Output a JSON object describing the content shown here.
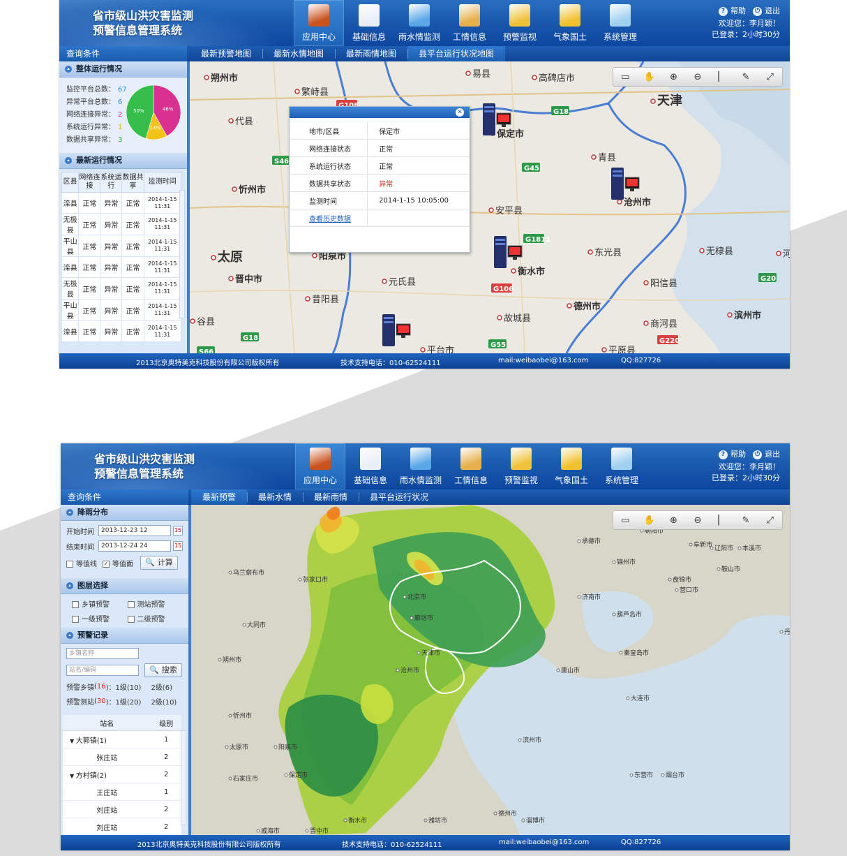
{
  "screens": [
    {
      "header": {
        "title_line1": "省市级山洪灾害监测",
        "title_line2": "预警信息管理系统",
        "nav": [
          {
            "label": "应用中心",
            "icon": "house-icon",
            "color": "#c9531e"
          },
          {
            "label": "基础信息",
            "icon": "document-icon",
            "color": "#e9eef7"
          },
          {
            "label": "雨水情监测",
            "icon": "rain-icon",
            "color": "#5aa8e8"
          },
          {
            "label": "工情信息",
            "icon": "report-icon",
            "color": "#e6b04c"
          },
          {
            "label": "预警监视",
            "icon": "warning-monitor-icon",
            "color": "#f0c23a"
          },
          {
            "label": "气象国土",
            "icon": "weather-icon",
            "color": "#f2c12f"
          },
          {
            "label": "系统管理",
            "icon": "settings-monitor-icon",
            "color": "#9fd0f0"
          }
        ],
        "help": "帮助",
        "logout": "退出",
        "welcome": "欢迎您：李月颖！",
        "logged": "已登录：2小时30分"
      },
      "query_title": "查询条件",
      "tabs": [
        "最新预警地图",
        "最新水情地图",
        "最新雨情地图",
        "县平台运行状况地图"
      ],
      "active_tab": 3,
      "overall": {
        "title": "整体运行情况",
        "rows": [
          {
            "label": "监控平台总数：",
            "value": "67",
            "color": "#2b8fe0"
          },
          {
            "label": "异常平台总数：",
            "value": "6",
            "color": "#2b8fe0"
          },
          {
            "label": "网络连接异常：",
            "value": "2",
            "color": "#d6197c"
          },
          {
            "label": "系统运行异常：",
            "value": "1",
            "color": "#e8b51a"
          },
          {
            "label": "数据共享异常：",
            "value": "3",
            "color": "#2aa83c"
          }
        ],
        "pie": [
          {
            "label": "46%",
            "value": 46,
            "color": "#d9318f"
          },
          {
            "label": "14%",
            "value": 14,
            "color": "#f2c218"
          },
          {
            "label": "50%",
            "value": 50,
            "color": "#35be49"
          }
        ]
      },
      "latest": {
        "title": "最新运行情况",
        "headers": [
          "区县",
          "网络连接",
          "系统运行",
          "数据共享",
          "监测时间"
        ],
        "rows": [
          [
            "滦县",
            "正常",
            "异常",
            "正常",
            "2014-1-15 11:31"
          ],
          [
            "无极县",
            "正常",
            "异常",
            "正常",
            "2014-1-15 11:31"
          ],
          [
            "平山县",
            "正常",
            "异常",
            "正常",
            "2014-1-15 11:31"
          ],
          [
            "滦县",
            "正常",
            "异常",
            "正常",
            "2014-1-15 11:31"
          ],
          [
            "无极县",
            "正常",
            "异常",
            "正常",
            "2014-1-15 11:31"
          ],
          [
            "平山县",
            "正常",
            "异常",
            "正常",
            "2014-1-15 11:31"
          ],
          [
            "滦县",
            "正常",
            "异常",
            "正常",
            "2014-1-15 11:31"
          ]
        ]
      },
      "popup": {
        "rows": [
          {
            "label": "地市/区县",
            "value": "保定市",
            "color": "#222"
          },
          {
            "label": "网络连接状态",
            "value": "正常",
            "color": "#222"
          },
          {
            "label": "系统运行状态",
            "value": "正常",
            "color": "#222"
          },
          {
            "label": "数据共享状态",
            "value": "异常",
            "color": "#d42020"
          },
          {
            "label": "监测时间",
            "value": "2014-1-15 10:05:00",
            "color": "#222"
          }
        ],
        "link": "查看历史数据"
      },
      "map_labels": [
        "朔州市",
        "繁峙县",
        "易县",
        "高碑店市",
        "天津",
        "代县",
        "保定市",
        "青县",
        "忻州市",
        "安平县",
        "沧州市",
        "太原",
        "阳泉市",
        "东光县",
        "无棣县",
        "晋中市",
        "衡水市",
        "元氏县",
        "阳信县",
        "昔阳县",
        "德州市",
        "河",
        "故城县",
        "商河县",
        "滨州市",
        "谷县",
        "平台市",
        "平原县"
      ],
      "road_shields": [
        "G108",
        "G18",
        "S46",
        "G45",
        "G1811",
        "G106",
        "G18",
        "G55",
        "G20",
        "G220",
        "S66"
      ],
      "footer": {
        "copyright": "2013北京奥特美克科技股份有限公司版权所有",
        "phone": "技术支持电话：010-62524111",
        "mail": "mail:weibaobei@163.com",
        "qq": "QQ:827726"
      }
    },
    {
      "header": {
        "title_line1": "省市级山洪灾害监测",
        "title_line2": "预警信息管理系统",
        "nav": [
          {
            "label": "应用中心",
            "icon": "house-icon",
            "color": "#c9531e"
          },
          {
            "label": "基础信息",
            "icon": "document-icon",
            "color": "#e9eef7"
          },
          {
            "label": "雨水情监测",
            "icon": "rain-icon",
            "color": "#5aa8e8"
          },
          {
            "label": "工情信息",
            "icon": "report-icon",
            "color": "#e6b04c"
          },
          {
            "label": "预警监视",
            "icon": "warning-monitor-icon",
            "color": "#f0c23a"
          },
          {
            "label": "气象国土",
            "icon": "weather-icon",
            "color": "#f2c12f"
          },
          {
            "label": "系统管理",
            "icon": "settings-monitor-icon",
            "color": "#9fd0f0"
          }
        ],
        "help": "帮助",
        "logout": "退出",
        "welcome": "欢迎您：李月颖！",
        "logged": "已登录：2小时30分"
      },
      "query_title": "查询条件",
      "tabs": [
        "最新预警",
        "最新水情",
        "最新雨情",
        "县平台运行状况"
      ],
      "active_tab": 0,
      "rain": {
        "title": "降雨分布",
        "start_label": "开始时间",
        "start_value": "2013-12-23 12",
        "end_label": "结束时间",
        "end_value": "2013-12-24 24",
        "isoline": "等值线",
        "isosurface": "等值面",
        "calc": "计算"
      },
      "layers": {
        "title": "图层选择",
        "items": [
          "乡镇预警",
          "测站预警",
          "一级预警",
          "二级预警"
        ]
      },
      "records": {
        "title": "预警记录",
        "town_placeholder": "乡镇名称",
        "station_placeholder": "站名/编码",
        "search": "搜索",
        "town_line": {
          "label": "预警乡镇",
          "count": "16",
          "l1": "1级(10)",
          "l2": "2级(6)"
        },
        "station_line": {
          "label": "预警测站",
          "count": "30",
          "l1": "1级(20)",
          "l2": "2级(10)"
        },
        "headers": [
          "站名",
          "级别"
        ],
        "rows": [
          {
            "name": "大郭镇(1)",
            "level": "1",
            "group": true
          },
          {
            "name": "张庄站",
            "level": "2",
            "group": false
          },
          {
            "name": "方村镇(2)",
            "level": "2",
            "group": true
          },
          {
            "name": "王庄站",
            "level": "1",
            "group": false
          },
          {
            "name": "刘庄站",
            "level": "2",
            "group": false
          },
          {
            "name": "刘庄站",
            "level": "2",
            "group": false
          }
        ]
      },
      "map_labels": [
        "承德市",
        "朝阳市",
        "阜新市",
        "锦州市",
        "辽阳市",
        "本溪市",
        "鞍山市",
        "盘锦市",
        "营口市",
        "乌兰察布市",
        "张家口市",
        "北京市",
        "廊坊市",
        "天津市",
        "大同市",
        "朔州市",
        "丹东市",
        "大连市",
        "忻州市",
        "太原市",
        "阳泉市",
        "保定市",
        "石家庄市",
        "沧州市",
        "滨州市",
        "东营市",
        "烟台市",
        "威海市",
        "晋中市",
        "衡水市",
        "德州市",
        "淄博市",
        "潍坊市",
        "济南市",
        "葫芦岛市",
        "秦皇岛市",
        "唐山市"
      ],
      "footer": {
        "copyright": "2013北京奥特美克科技股份有限公司版权所有",
        "phone": "技术支持电话：010-62524111",
        "mail": "mail:weibaobei@163.com",
        "qq": "QQ:827726"
      }
    }
  ],
  "toolbar": [
    "screen-icon",
    "pan-hand-icon",
    "zoom-in-icon",
    "zoom-out-icon",
    "measure-icon",
    "edit-icon",
    "fullscreen-icon"
  ]
}
